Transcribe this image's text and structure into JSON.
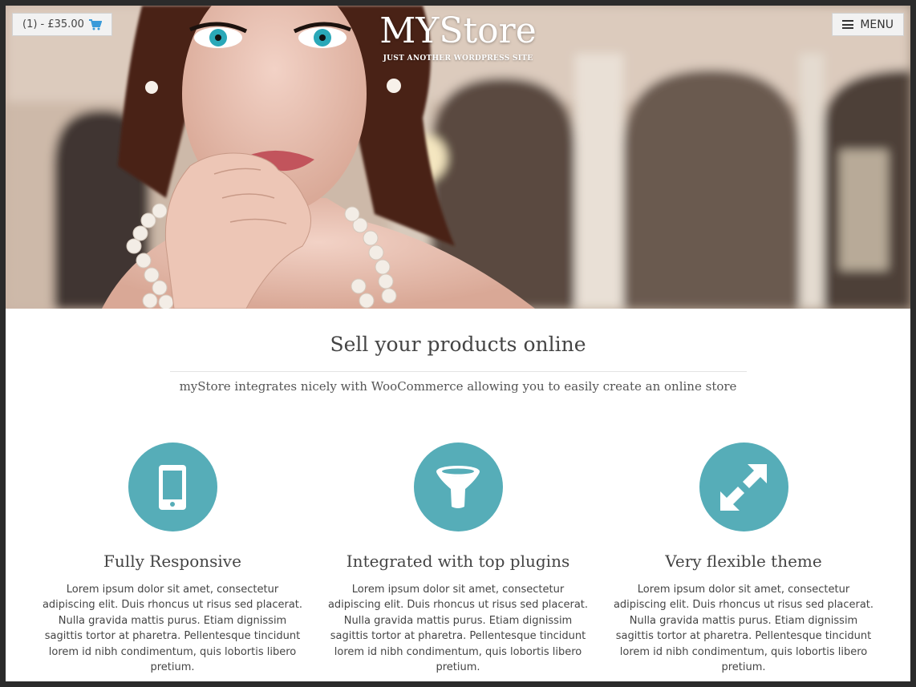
{
  "header": {
    "cart_label": "(1) - £35.00",
    "menu_label": "MENU",
    "site_title": "MYStore",
    "tagline": "JUST ANOTHER WORDPRESS SITE"
  },
  "intro": {
    "title": "Sell your products online",
    "subtitle": "myStore integrates nicely with WooCommerce allowing you to easily create an online store"
  },
  "features": [
    {
      "icon": "mobile-phone-icon",
      "title": "Fully Responsive",
      "text": "Lorem ipsum dolor sit amet, consectetur adipiscing elit. Duis rhoncus ut risus sed placerat. Nulla gravida mattis purus. Etiam dignissim sagittis tortor at pharetra. Pellentesque tincidunt lorem id nibh condimentum, quis lobortis libero pretium."
    },
    {
      "icon": "funnel-icon",
      "title": "Integrated with top plugins",
      "text": "Lorem ipsum dolor sit amet, consectetur adipiscing elit. Duis rhoncus ut risus sed placerat. Nulla gravida mattis purus. Etiam dignissim sagittis tortor at pharetra. Pellentesque tincidunt lorem id nibh condimentum, quis lobortis libero pretium."
    },
    {
      "icon": "expand-arrows-icon",
      "title": "Very flexible theme",
      "text": "Lorem ipsum dolor sit amet, consectetur adipiscing elit. Duis rhoncus ut risus sed placerat. Nulla gravida mattis purus. Etiam dignissim sagittis tortor at pharetra. Pellentesque tincidunt lorem id nibh condimentum, quis lobortis libero pretium."
    }
  ],
  "colors": {
    "accent": "#56adb8",
    "cart_icon": "#3a9ad9",
    "text": "#444444"
  }
}
